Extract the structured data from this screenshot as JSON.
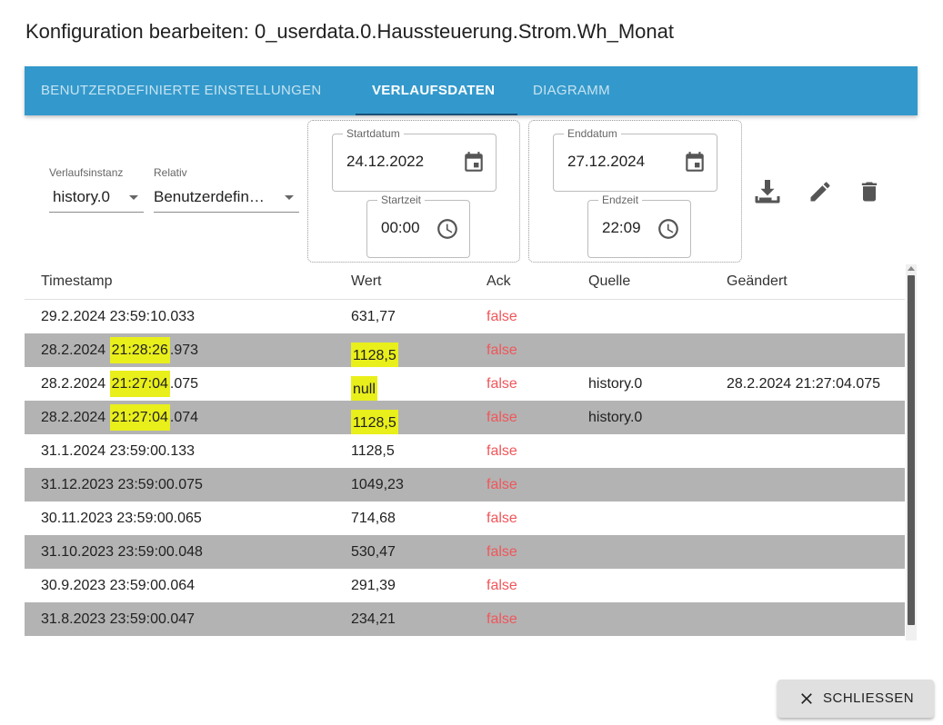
{
  "dialog": {
    "title": "Konfiguration bearbeiten: 0_userdata.0.Haussteuerung.Strom.Wh_Monat"
  },
  "tabs": [
    {
      "label": "BENUTZERDEFINIERTE EINSTELLUNGEN"
    },
    {
      "label": "VERLAUFSDATEN"
    },
    {
      "label": "DIAGRAMM"
    }
  ],
  "filters": {
    "instance_label": "Verlaufsinstanz",
    "instance_value": "history.0",
    "relative_label": "Relativ",
    "relative_value": "Benutzerdefin…",
    "start_date_label": "Startdatum",
    "start_date_value": "24.12.2022",
    "start_time_label": "Startzeit",
    "start_time_value": "00:00",
    "end_date_label": "Enddatum",
    "end_date_value": "27.12.2024",
    "end_time_label": "Endzeit",
    "end_time_value": "22:09"
  },
  "icons": {
    "calendar": "calendar-icon",
    "clock": "clock-icon",
    "download": "download-icon",
    "edit": "pencil-icon",
    "delete": "trash-icon",
    "close": "close-icon"
  },
  "colors": {
    "tab_bar": "#3399cc",
    "ack_false": "#f0565a",
    "highlight": "#e9ef1a",
    "row_alt": "#b3b3b3"
  },
  "table": {
    "headers": [
      "Timestamp",
      "Wert",
      "Ack",
      "Quelle",
      "Geändert"
    ],
    "rows": [
      {
        "ts_a": "29.2.2024 23:59:10.033",
        "ts_b": "",
        "ts_c": "",
        "value": "631,77",
        "ack": "false",
        "source": "",
        "changed": ""
      },
      {
        "ts_a": "28.2.2024 ",
        "ts_b": "21:28:26",
        "ts_c": ".973",
        "value": "1128,5",
        "ack": "false",
        "source": "",
        "changed": ""
      },
      {
        "ts_a": "28.2.2024 ",
        "ts_b": "21:27:04",
        "ts_c": ".075",
        "value": "null",
        "ack": "false",
        "source": "history.0",
        "changed": "28.2.2024 21:27:04.075"
      },
      {
        "ts_a": "28.2.2024 ",
        "ts_b": "21:27:04",
        "ts_c": ".074",
        "value": "1128,5",
        "ack": "false",
        "source": "history.0",
        "changed": ""
      },
      {
        "ts_a": "31.1.2024 23:59:00.133",
        "ts_b": "",
        "ts_c": "",
        "value": "1128,5",
        "ack": "false",
        "source": "",
        "changed": ""
      },
      {
        "ts_a": "31.12.2023 23:59:00.075",
        "ts_b": "",
        "ts_c": "",
        "value": "1049,23",
        "ack": "false",
        "source": "",
        "changed": ""
      },
      {
        "ts_a": "30.11.2023 23:59:00.065",
        "ts_b": "",
        "ts_c": "",
        "value": "714,68",
        "ack": "false",
        "source": "",
        "changed": ""
      },
      {
        "ts_a": "31.10.2023 23:59:00.048",
        "ts_b": "",
        "ts_c": "",
        "value": "530,47",
        "ack": "false",
        "source": "",
        "changed": ""
      },
      {
        "ts_a": "30.9.2023 23:59:00.064",
        "ts_b": "",
        "ts_c": "",
        "value": "291,39",
        "ack": "false",
        "source": "",
        "changed": ""
      },
      {
        "ts_a": "31.8.2023 23:59:00.047",
        "ts_b": "",
        "ts_c": "",
        "value": "234,21",
        "ack": "false",
        "source": "",
        "changed": ""
      }
    ]
  },
  "footer": {
    "close_label": "SCHLIESSEN"
  }
}
